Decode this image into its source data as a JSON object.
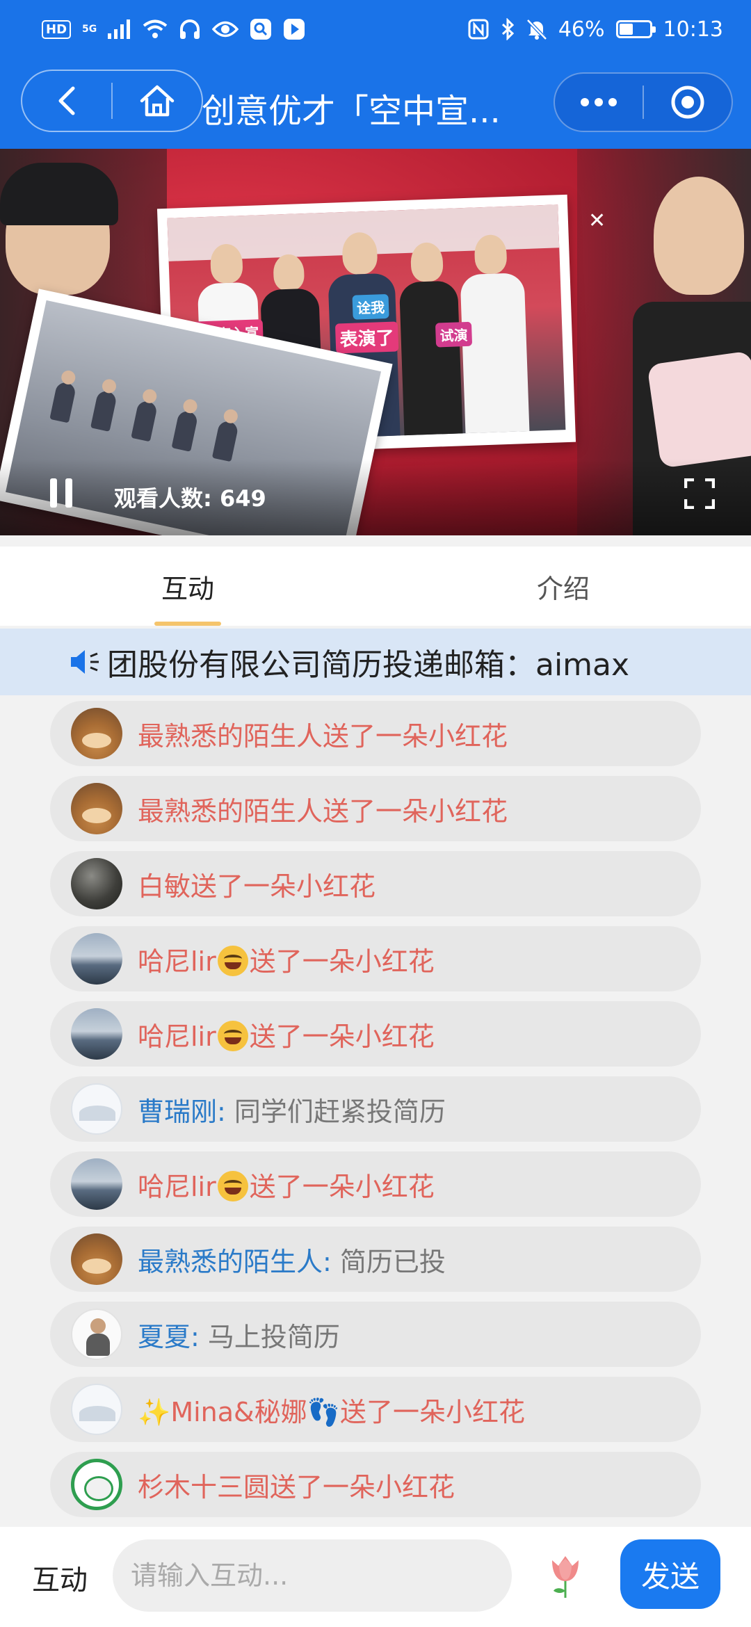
{
  "status_bar": {
    "hd_badge": "HD",
    "network": "5G",
    "battery_text": "46%",
    "battery_level": 0.46,
    "time": "10:13",
    "icons": [
      "hd-icon",
      "signal-icon",
      "wifi-icon",
      "headphones-icon",
      "eye-icon",
      "search-app-icon",
      "play-app-icon",
      "nfc-icon",
      "bluetooth-icon",
      "mute-icon",
      "battery-icon"
    ]
  },
  "header": {
    "title": "创意优才「空中宣...",
    "icons": [
      "back-icon",
      "home-icon",
      "more-icon",
      "record-icon"
    ],
    "accent": "#1a73e8"
  },
  "video": {
    "viewers_label": "观看人数:",
    "viewers_count": "649",
    "signs": [
      "今日提高入宣",
      "表演了",
      "试演",
      "诠我"
    ],
    "icons": [
      "pause-icon",
      "fullscreen-icon",
      "close-icon"
    ]
  },
  "tabs": [
    {
      "label": "互动",
      "active": true
    },
    {
      "label": "介绍",
      "active": false
    }
  ],
  "marquee": {
    "text": "团股份有限公司简历投递邮箱：aimax",
    "icon": "speaker-icon"
  },
  "chat": [
    {
      "avatar": "dog",
      "type": "gift",
      "text": "最熟悉的陌生人送了一朵小红花"
    },
    {
      "avatar": "dog",
      "type": "gift",
      "text": "最熟悉的陌生人送了一朵小红花"
    },
    {
      "avatar": "dark",
      "type": "gift",
      "text": "白敏送了一朵小红花"
    },
    {
      "avatar": "lake",
      "type": "gift_emoji",
      "pre": "哈尼lir",
      "post": "送了一朵小红花"
    },
    {
      "avatar": "lake",
      "type": "gift_emoji",
      "pre": "哈尼lir",
      "post": "送了一朵小红花"
    },
    {
      "avatar": "plain",
      "type": "comment",
      "user": "曹瑞刚",
      "colon": ":",
      "text": "同学们赶紧投简历"
    },
    {
      "avatar": "lake",
      "type": "gift_emoji",
      "pre": "哈尼lir",
      "post": "送了一朵小红花"
    },
    {
      "avatar": "dog",
      "type": "comment",
      "user": "最熟悉的陌生人",
      "colon": ":",
      "text": "简历已投"
    },
    {
      "avatar": "person",
      "type": "comment",
      "user": "夏夏",
      "colon": ":",
      "text": "马上投简历"
    },
    {
      "avatar": "plain",
      "type": "gift",
      "text": "✨Mina&秘娜👣送了一朵小红花"
    },
    {
      "avatar": "green",
      "type": "gift",
      "text": "杉木十三圆送了一朵小红花"
    }
  ],
  "bottom_bar": {
    "label": "互动",
    "input_placeholder": "请输入互动...",
    "input_value": "",
    "send_label": "发送",
    "icons": [
      "flower-icon"
    ],
    "send_color": "#1a7af0"
  }
}
